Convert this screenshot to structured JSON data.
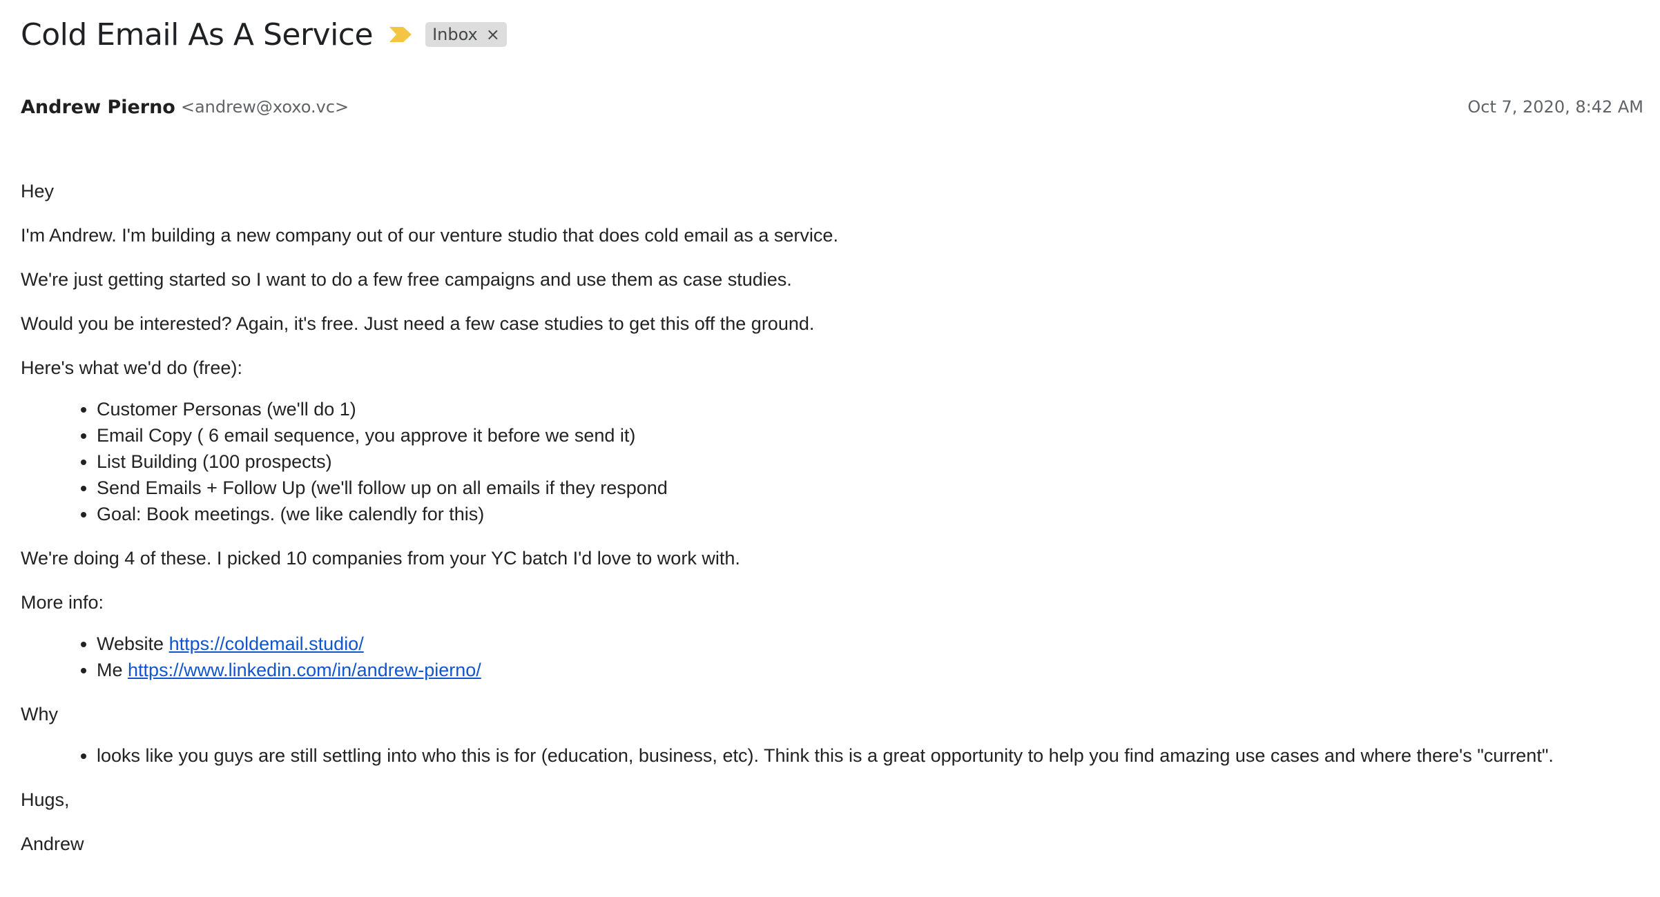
{
  "email": {
    "subject": "Cold Email As A Service",
    "importance_icon": "importance-marker-icon",
    "label_chip": {
      "text": "Inbox",
      "close_glyph": "×"
    },
    "sender": {
      "name": "Andrew Pierno",
      "email": "<andrew@xoxo.vc>"
    },
    "date": "Oct 7, 2020, 8:42 AM",
    "body": {
      "greeting": "Hey",
      "intro": "I'm Andrew. I'm building a new company out of our venture studio that does cold email as a service.",
      "getting_started": "We're just getting started so I want to do a few free campaigns and use them as case studies.",
      "interested": "Would you be interested? Again, it's free. Just need a few case studies to get this off the ground.",
      "offer_heading": "Here's what we'd do (free):",
      "offer_items": [
        "Customer Personas (we'll do 1)",
        "Email Copy ( 6 email sequence, you approve it before we send it)",
        "List Building (100 prospects)",
        "Send Emails + Follow Up (we'll follow up on all emails if they respond",
        "Goal: Book meetings. (we like calendly for this)"
      ],
      "batch_note": "We're doing 4 of these. I picked 10 companies from your YC batch I'd love to work with.",
      "more_info_heading": "More info:",
      "more_info_items": [
        {
          "label": "Website",
          "link": "https://coldemail.studio/"
        },
        {
          "label": "Me",
          "link": "https://www.linkedin.com/in/andrew-pierno/"
        }
      ],
      "why_heading": "Why",
      "why_items": [
        "looks like you guys are still settling into who this is for (education, business, etc). Think this is a great opportunity to help you find amazing use cases and where there's \"current\"."
      ],
      "signoff": "Hugs,",
      "signature": "Andrew"
    }
  },
  "colors": {
    "importance": "#f4c542",
    "link": "#1155cc",
    "chip_background": "#dddddd",
    "meta_text": "#5f6368"
  }
}
